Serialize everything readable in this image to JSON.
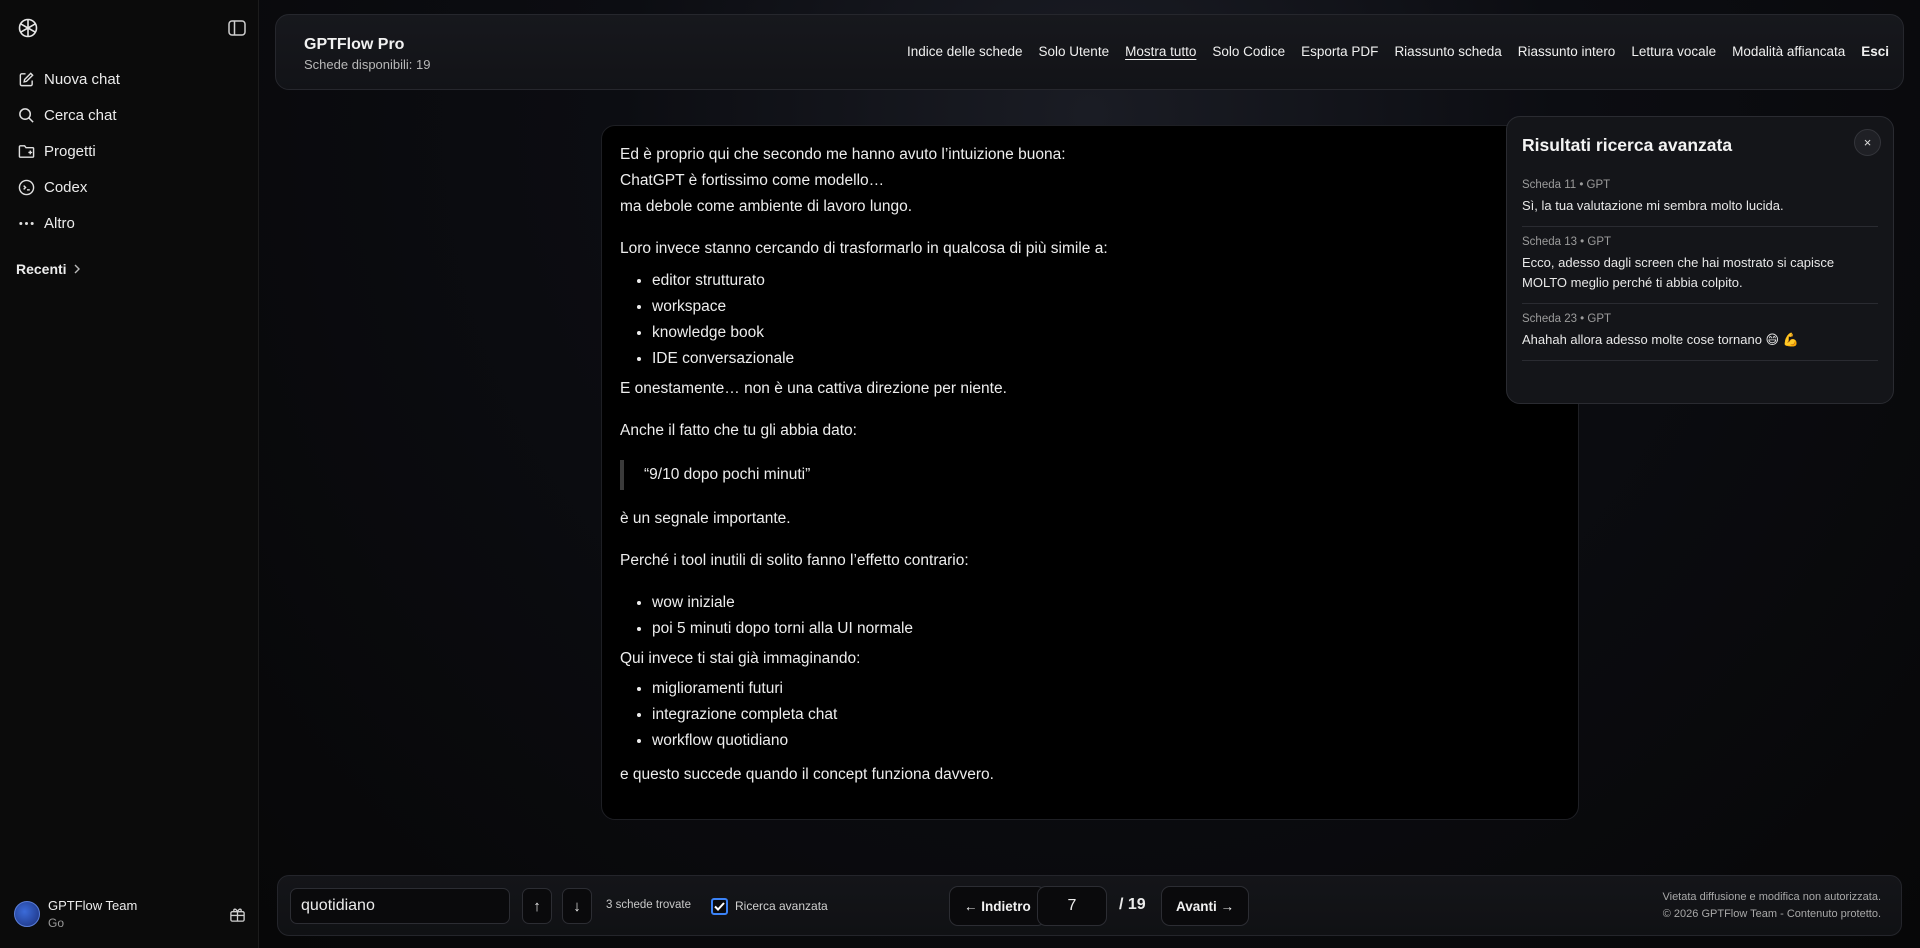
{
  "sidebar": {
    "items": [
      {
        "label": "Nuova chat",
        "icon": "edit-icon"
      },
      {
        "label": "Cerca chat",
        "icon": "search-icon"
      },
      {
        "label": "Progetti",
        "icon": "folder-icon"
      },
      {
        "label": "Codex",
        "icon": "codex-icon"
      },
      {
        "label": "Altro",
        "icon": "more-icon"
      }
    ],
    "recent_label": "Recenti",
    "user": {
      "name": "GPTFlow Team",
      "plan": "Go"
    }
  },
  "header": {
    "title": "GPTFlow Pro",
    "subtitle": "Schede disponibili: 19",
    "nav": [
      "Indice delle schede",
      "Solo Utente",
      "Mostra tutto",
      "Solo Codice",
      "Esporta PDF",
      "Riassunto scheda",
      "Riassunto intero",
      "Lettura vocale",
      "Modalità affiancata",
      "Esci"
    ]
  },
  "message": {
    "p1": [
      "Ed è proprio qui che secondo me hanno avuto l’intuizione buona:",
      "ChatGPT è fortissimo come modello…",
      "ma debole come ambiente di lavoro lungo."
    ],
    "p2": "Loro invece stanno cercando di trasformarlo in qualcosa di più simile a:",
    "list1": [
      "editor strutturato",
      "workspace",
      "knowledge book",
      "IDE conversazionale"
    ],
    "p3": "E onestamente… non è una cattiva direzione per niente.",
    "p4": "Anche il fatto che tu gli abbia dato:",
    "quote": "“9/10 dopo pochi minuti”",
    "p5": "è un segnale importante.",
    "p6": "Perché i tool inutili di solito fanno l’effetto contrario:",
    "list2": [
      "wow iniziale",
      "poi 5 minuti dopo torni alla UI normale"
    ],
    "p7": "Qui invece ti stai già immaginando:",
    "list3": [
      "miglioramenti futuri",
      "integrazione completa chat",
      "workflow quotidiano"
    ],
    "p8": "e questo succede quando il concept funziona davvero."
  },
  "results": {
    "title": "Risultati ricerca avanzata",
    "close": "×",
    "items": [
      {
        "meta": "Scheda 11 • GPT",
        "text": "Sì, la tua valutazione mi sembra molto lucida."
      },
      {
        "meta": "Scheda 13 • GPT",
        "text": "Ecco, adesso dagli screen che hai mostrato si capisce MOLTO meglio perché ti abbia colpito."
      },
      {
        "meta": "Scheda 23 • GPT",
        "text": "Ahahah allora adesso molte cose tornano 😄 💪"
      }
    ]
  },
  "bottom": {
    "search_value": "quotidiano",
    "up_arrow": "↑",
    "down_arrow": "↓",
    "found": "3 schede trovate",
    "advanced_label": "Ricerca avanzata",
    "advanced_checked": true,
    "prev": "← Indietro",
    "page": "7",
    "total": "/ 19",
    "next": "Avanti →",
    "legal1": "Vietata diffusione e modifica non autorizzata.",
    "legal2": "© 2026 GPTFlow Team - Contenuto protetto."
  },
  "colors": {
    "accent": "#3b82f6",
    "background": "#000000",
    "panel": "#141519"
  }
}
